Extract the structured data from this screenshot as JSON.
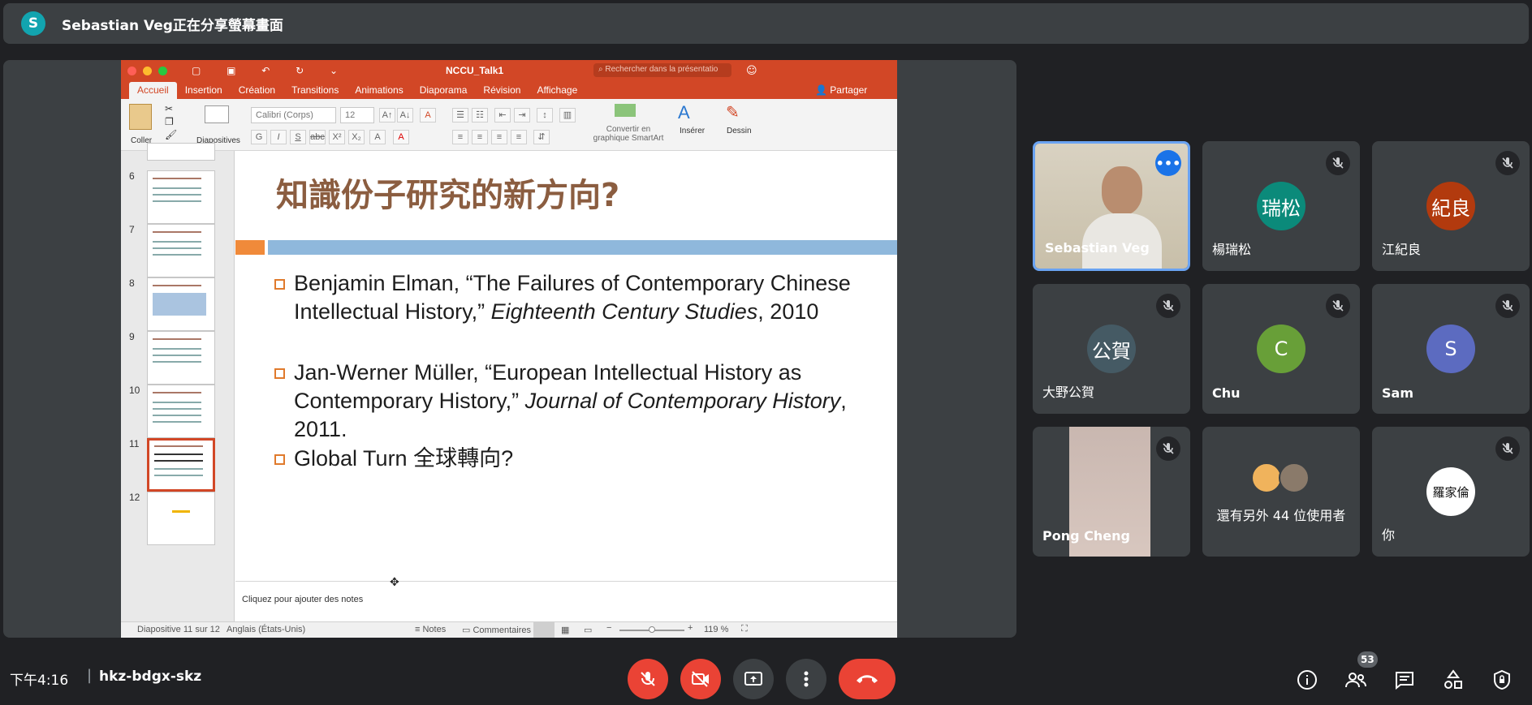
{
  "banner": {
    "avatar_letter": "S",
    "text": "Sebastian Veg正在分享螢幕畫面"
  },
  "ppt": {
    "window_title": "NCCU_Talk1",
    "search_placeholder": "Rechercher dans la présentatio",
    "tabs": [
      "Accueil",
      "Insertion",
      "Création",
      "Transitions",
      "Animations",
      "Diaporama",
      "Révision",
      "Affichage"
    ],
    "share_label": "Partager",
    "ribbon": {
      "paste": "Coller",
      "slides": "Diapositives",
      "font": "Calibri (Corps)",
      "size": "12",
      "smartart": "Convertir en graphique SmartArt",
      "insert": "Insérer",
      "draw": "Dessin"
    },
    "thumbs": [
      "6",
      "7",
      "8",
      "9",
      "10",
      "11",
      "12"
    ],
    "slide": {
      "title": "知識份子研究的新方向?",
      "bullet1_a": "Benjamin Elman, “The Failures of Contemporary Chinese Intellectual History,” ",
      "bullet1_i": "Eighteenth Century Studies",
      "bullet1_b": ", 2010",
      "bullet2_a": "Jan-Werner Müller, “European Intellectual History as Contemporary History,” ",
      "bullet2_i": "Journal of Contemporary History",
      "bullet2_b": ", 2011.",
      "bullet3": "Global Turn 全球轉向?"
    },
    "notes_placeholder": "Cliquez pour ajouter des notes",
    "status": {
      "slide_info": "Diapositive 11 sur 12",
      "language": "Anglais (États-Unis)",
      "notes": "Notes",
      "comments": "Commentaires",
      "zoom": "119 %"
    }
  },
  "participants": [
    {
      "name": "Sebastian Veg",
      "type": "video"
    },
    {
      "name": "楊瑞松",
      "avatar": "瑞松",
      "color": "#0b8a7a"
    },
    {
      "name": "江紀良",
      "avatar": "紀良",
      "color": "#b23a0e"
    },
    {
      "name": "大野公賀",
      "avatar": "公賀",
      "color": "#455a64"
    },
    {
      "name": "Chu",
      "avatar": "C",
      "color": "#689f38"
    },
    {
      "name": "Sam",
      "avatar": "S",
      "color": "#5c6bc0"
    },
    {
      "name": "Pong Cheng",
      "type": "video"
    },
    {
      "name": "還有另外 44 位使用者",
      "type": "group"
    },
    {
      "name": "你",
      "avatar": "羅家倫",
      "type": "self"
    }
  ],
  "meeting": {
    "time": "下午4:16",
    "code": "hkz-bdgx-skz",
    "participant_count": "53"
  }
}
